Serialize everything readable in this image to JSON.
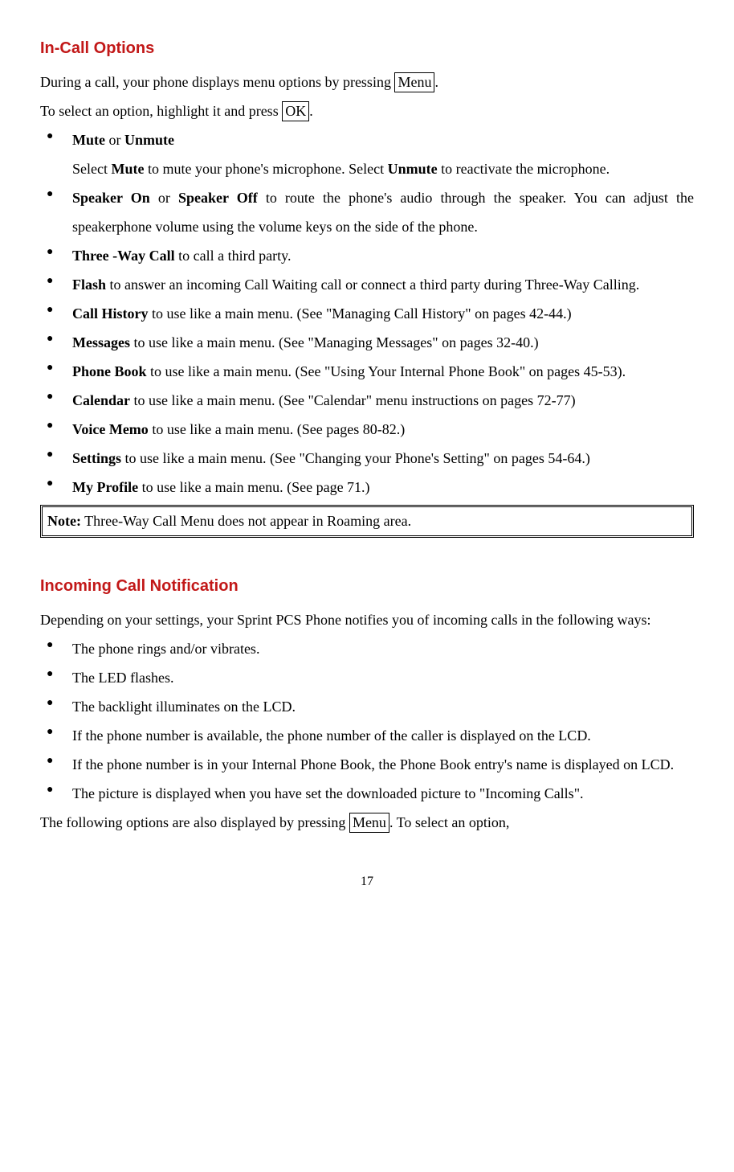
{
  "section1": {
    "heading": "In-Call Options",
    "intro1a": "During a call, your phone displays menu options by pressing ",
    "intro1key": "Menu",
    "intro1b": ".",
    "intro2a": "To select an option, highlight it and press ",
    "intro2key": "OK",
    "intro2b": ".",
    "items": {
      "mute": {
        "b1": "Mute",
        "t1": " or ",
        "b2": "Unmute",
        "line2a": "Select ",
        "line2b": "Mute",
        "line2c": " to mute your phone's microphone. Select ",
        "line2d": "Unmute",
        "line2e": " to reactivate the microphone."
      },
      "speaker": {
        "b1": "Speaker On",
        "t1": " or ",
        "b2": "Speaker Off",
        "t2": " to route the phone's audio through the speaker. You can adjust the speakerphone volume using the volume keys on the side of the phone."
      },
      "threeway": {
        "b": "Three -Way Call",
        "t": " to call a third party."
      },
      "flash": {
        "b": "Flash",
        "t": " to answer an incoming Call Waiting call or connect a third party during Three-Way Calling."
      },
      "callhist": {
        "b": "Call History",
        "t": " to use like a main menu. (See \"Managing Call History\" on pages 42-44.)"
      },
      "messages": {
        "b": "Messages",
        "t": " to use like a main menu. (See \"Managing Messages\" on pages 32-40.)"
      },
      "phonebook": {
        "b": "Phone Book",
        "t": " to use like a main menu. (See \"Using Your Internal Phone Book\" on pages 45-53)."
      },
      "calendar": {
        "b": "Calendar",
        "t": " to use like a main menu. (See \"Calendar\" menu instructions on pages 72-77)"
      },
      "voicememo": {
        "b": "Voice Memo",
        "t": " to use like a main menu. (See pages 80-82.)"
      },
      "settings": {
        "b": "Settings",
        "t": " to use like a main menu. (See \"Changing your Phone's Setting\" on pages 54-64.)"
      },
      "myprofile": {
        "b": "My Profile",
        "t": " to use like a main menu. (See page 71.)"
      }
    },
    "note_b": "Note:",
    "note_t": " Three-Way Call Menu does not appear in Roaming area."
  },
  "section2": {
    "heading": "Incoming Call Notification",
    "intro": "Depending on your settings, your Sprint PCS Phone notifies you of incoming calls in the following ways:",
    "items": {
      "i1": "The phone rings and/or vibrates.",
      "i2": "The LED flashes.",
      "i3": "The backlight illuminates on the LCD.",
      "i4": "If the phone number is available, the phone number of the caller is displayed on the LCD.",
      "i5": "If the phone number is in your Internal Phone Book, the Phone Book entry's name is displayed on LCD.",
      "i6": "The picture is displayed when you have set the downloaded picture to \"Incoming Calls\"."
    },
    "tail_a": "The following options are also displayed by pressing ",
    "tail_key": "Menu",
    "tail_b": ". To select an option,"
  },
  "pagenum": "17"
}
